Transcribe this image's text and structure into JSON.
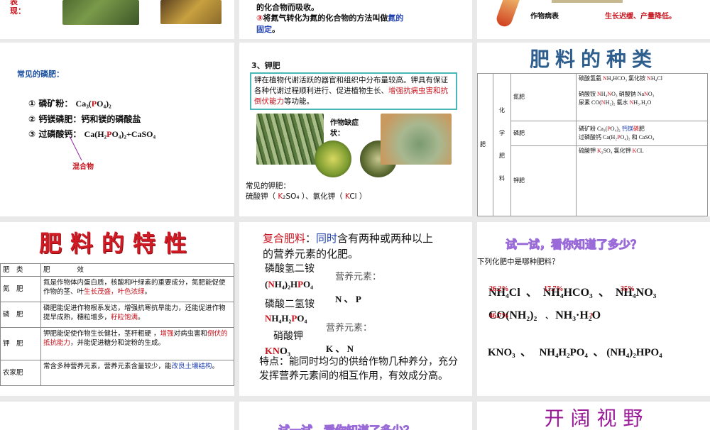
{
  "slides": {
    "s1": {
      "label": "表现：",
      "images": [
        "nitrogen-deficient-crop-photo",
        "yellow-leaf-photo"
      ]
    },
    "s2": {
      "line1": "的化合物而吸收。",
      "line2": [
        {
          "t": "③",
          "c": "r"
        },
        {
          "t": "将氮气转化为氮的化合物的方法叫做"
        },
        {
          "t": "氮的固定",
          "c": "b"
        },
        {
          "t": "。"
        }
      ]
    },
    "s3": {
      "caption": "作物病表",
      "effect": "生长迟缓、产量降低。"
    },
    "s4": {
      "title": "常见的磷肥：",
      "items": [
        [
          {
            "t": "① 磷矿粉：  "
          },
          {
            "t": "Ca₃(",
            "s": 1
          },
          {
            "t": "P",
            "c": "r",
            "s": 1
          },
          {
            "t": "O₄)₂",
            "s": 1
          }
        ],
        [
          {
            "t": "② 钙镁磷肥：钙和镁的磷酸盐"
          }
        ],
        [
          {
            "t": "③ 过磷酸钙：  "
          },
          {
            "t": "Ca(H₂",
            "s": 1
          },
          {
            "t": "P",
            "c": "r",
            "s": 1
          },
          {
            "t": "O₄)₂+CaSO₄",
            "s": 1
          }
        ]
      ],
      "note": "混合物"
    },
    "s5": {
      "title": "3、钾肥",
      "box": [
        {
          "t": "钾在植物代谢活跃的器官和组织中分布量较高。钾具有保证各种代谢过程顺利进行、促进植物生长、"
        },
        {
          "t": "增强抗病虫害和抗倒伏能力",
          "c": "r"
        },
        {
          "t": "等功能。"
        }
      ],
      "symptom": "作物缺症状：",
      "common": "常见的钾肥：",
      "list": [
        {
          "t": "硫酸钾（ "
        },
        {
          "t": "K",
          "c": "r"
        },
        {
          "t": "₂SO₄ ）、氯化钾（ "
        },
        {
          "t": "K",
          "c": "r"
        },
        {
          "t": "Cl ）"
        }
      ]
    },
    "s6": {
      "title": "肥料的种类",
      "root": "肥",
      "chem": [
        "化",
        "学",
        "肥",
        "料"
      ],
      "rows": [
        {
          "type": "氮肥",
          "lines": [
            [
              {
                "t": "碳酸氢氨 "
              },
              {
                "t": "N",
                "c": "r"
              },
              {
                "t": "H₄HCO₃  氯化铵 "
              },
              {
                "t": "N",
                "c": "r"
              },
              {
                "t": "H₄Cl"
              }
            ],
            [
              {
                "t": "硝酸铵 "
              },
              {
                "t": "N",
                "c": "r"
              },
              {
                "t": "H₄"
              },
              {
                "t": "N",
                "c": "r"
              },
              {
                "t": "O₃     硝酸钠 Na"
              },
              {
                "t": "N",
                "c": "r"
              },
              {
                "t": "O₃"
              }
            ],
            [
              {
                "t": "尿素 CO("
              },
              {
                "t": "N",
                "c": "r"
              },
              {
                "t": "H₂)₂     氨水 "
              },
              {
                "t": "N",
                "c": "r"
              },
              {
                "t": "H₃.H₂O"
              }
            ]
          ]
        },
        {
          "type": "磷肥",
          "lines": [
            [
              {
                "t": "磷矿粉 Ca₃("
              },
              {
                "t": "P",
                "c": "r"
              },
              {
                "t": "O₄)₂     "
              },
              {
                "t": "钙镁",
                "c": "b"
              },
              {
                "t": "磷",
                "c": "r"
              },
              {
                "t": "肥"
              }
            ],
            [
              {
                "t": "过磷酸钙     Ca(H₂"
              },
              {
                "t": "P",
                "c": "r"
              },
              {
                "t": "O₄)₂ 和 CaSO₄"
              }
            ]
          ]
        },
        {
          "type": "钾肥",
          "lines": [
            [
              {
                "t": "硫酸钾  "
              },
              {
                "t": "K",
                "c": "r"
              },
              {
                "t": "₂SO₄  氯化钾  "
              },
              {
                "t": "K",
                "c": "r"
              },
              {
                "t": "CL"
              }
            ]
          ]
        }
      ]
    },
    "s7": {
      "title": "肥料的特性",
      "headers": [
        "肥　类",
        "肥　　　　效"
      ],
      "rows": [
        {
          "type": "氮　肥",
          "effect": [
            {
              "t": "氮是作物体内蛋白质，核酸和叶绿素的重要成分，氮肥能促使作物的茎、叶"
            },
            {
              "t": "生长茂盛，叶色浓绿",
              "c": "r"
            },
            {
              "t": "。"
            }
          ]
        },
        {
          "type": "磷　肥",
          "effect": [
            {
              "t": "磷肥能促进作物根系发达，增强抗寒抗旱能力，还能促进作物提早成熟，穗粒增多，"
            },
            {
              "t": "籽粒饱满",
              "c": "r"
            },
            {
              "t": "。"
            }
          ]
        },
        {
          "type": "钾　肥",
          "effect": [
            {
              "t": "钾肥能促使作物生长健壮，茎秆粗硬 ，"
            },
            {
              "t": "增强",
              "c": "r"
            },
            {
              "t": "对病虫害和"
            },
            {
              "t": "倒伏的抵抗能力",
              "c": "r"
            },
            {
              "t": "，并能促进糖分和淀粉的生成。"
            }
          ]
        },
        {
          "type": "农家肥",
          "effect": [
            {
              "t": "常含多种营养元素，营养元素含量较少，能"
            },
            {
              "t": "改良土壤结构",
              "c": "b"
            },
            {
              "t": "。"
            }
          ]
        }
      ]
    },
    "s8": {
      "intro": [
        {
          "t": "复合肥料",
          "c": "r"
        },
        {
          "t": "："
        },
        {
          "t": "同时",
          "c": "b"
        },
        {
          "t": "含有两种或两种以上的营养元素的化肥。"
        }
      ],
      "c1_name": "磷酸氢二铵",
      "c1_formula": [
        {
          "t": "("
        },
        {
          "t": "N",
          "c": "r"
        },
        {
          "t": "H₄)₂H"
        },
        {
          "t": "P",
          "c": "r"
        },
        {
          "t": "O₄"
        }
      ],
      "c2_name": "磷酸二氢铵",
      "c2_formula": [
        {
          "t": "N",
          "c": "r"
        },
        {
          "t": "H₄H₂"
        },
        {
          "t": "P",
          "c": "r"
        },
        {
          "t": "O₄"
        }
      ],
      "c3_name": "硝酸钾",
      "c3_formula": [
        {
          "t": "KN",
          "c": "r"
        },
        {
          "t": "O₃"
        }
      ],
      "nutrient_label": "营养元素：",
      "nutrients1": "N 、 P",
      "nutrients2": "K 、 N",
      "feature": "特点：能同时均匀的供给作物几种养分，充分发挥营养元素间的相互作用，有效成分高。"
    },
    "s9": {
      "title": "试一试，看你知道了多少？",
      "question": "下列化肥中是哪种肥料？",
      "row1": [
        "NH₄Cl",
        "NH₄HCO₃",
        "NH₄NO₃"
      ],
      "row1_pct": [
        "26.2%",
        "17.7%",
        "35%"
      ],
      "row2": [
        "CO(NH₂)₂",
        "NH₃·H₂O"
      ],
      "row2_pct": [
        "46.7%",
        "?"
      ],
      "row3": [
        "KNO₃",
        "NH₄H₂PO₄",
        "(NH₄)₂HPO₄"
      ],
      "sep": "、"
    },
    "s11": {
      "title": "试一试，看你知道了多少？"
    },
    "s12": {
      "title": "开 阔 视 野"
    }
  }
}
